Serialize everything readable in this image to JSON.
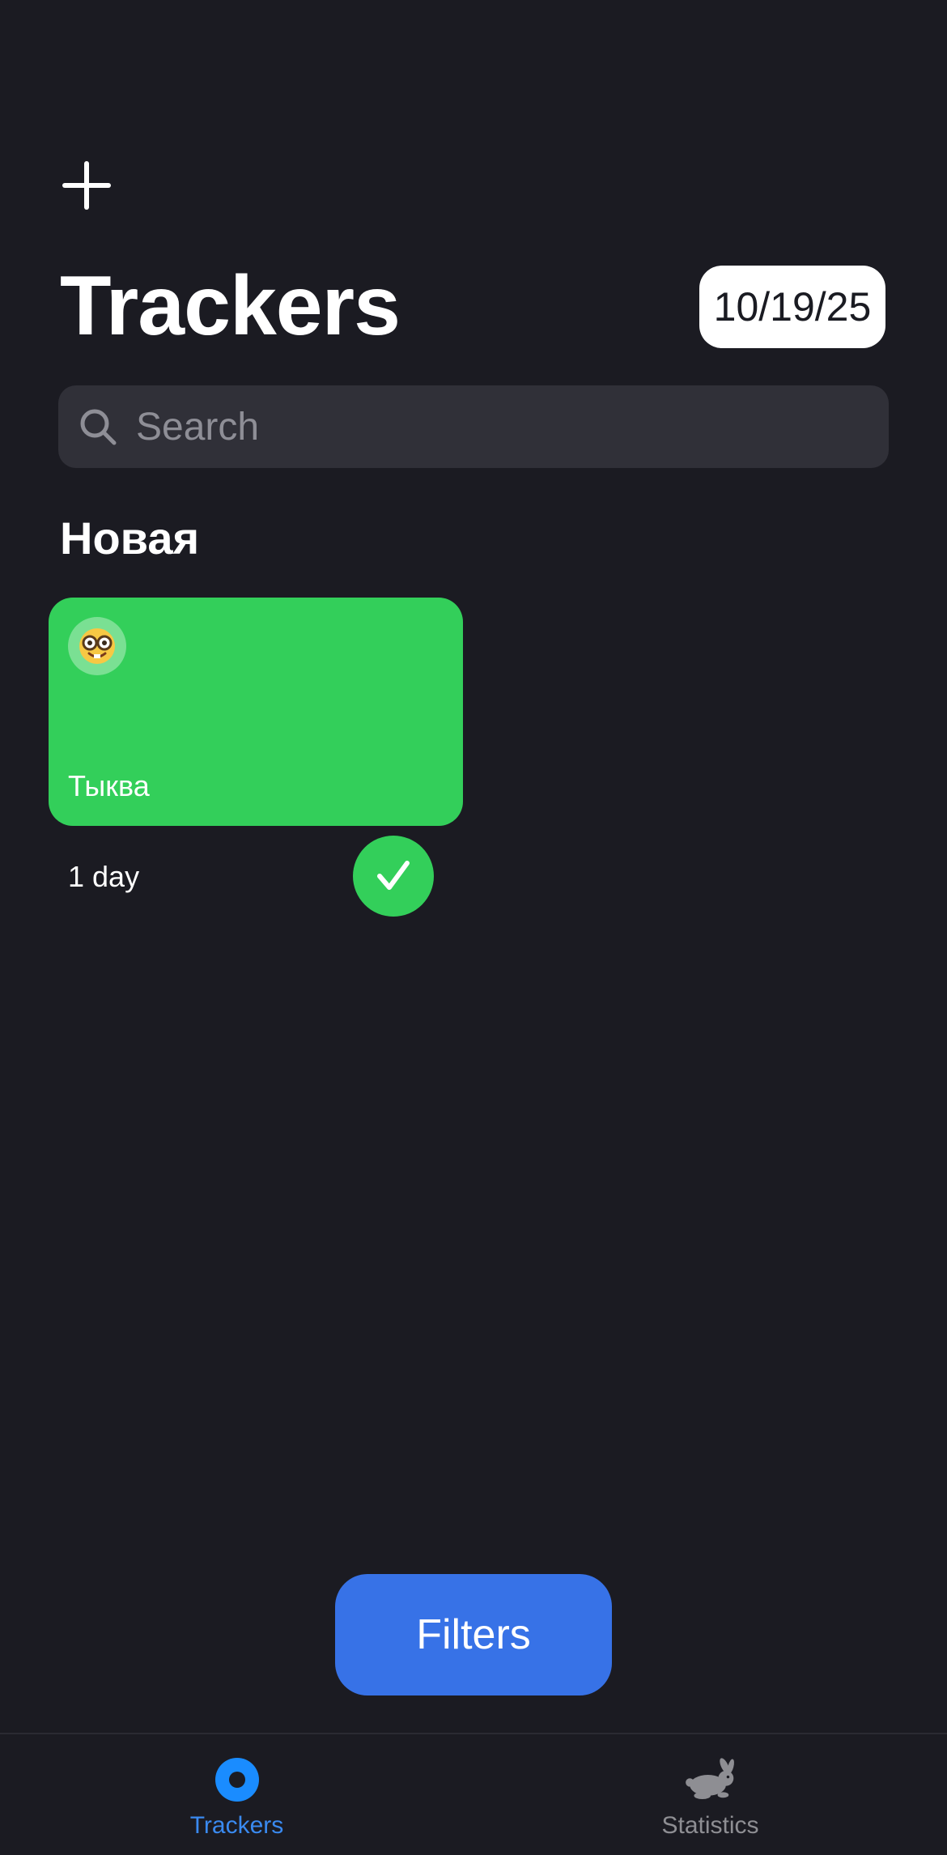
{
  "header": {
    "add_icon": "plus-icon",
    "title": "Trackers",
    "date": "10/19/25"
  },
  "search": {
    "placeholder": "Search",
    "value": "",
    "icon": "search-icon"
  },
  "sections": [
    {
      "title": "Новая",
      "trackers": [
        {
          "emoji": "🤓",
          "name": "Тыква",
          "color": "#33CF5A",
          "days_label": "1 day",
          "completed": true
        }
      ]
    }
  ],
  "filters_button": {
    "label": "Filters",
    "color": "#3772E7"
  },
  "tab_bar": {
    "tabs": [
      {
        "label": "Trackers",
        "icon": "trackers-record-icon",
        "active": true,
        "color": "#3A8AF0"
      },
      {
        "label": "Statistics",
        "icon": "rabbit-icon",
        "active": false,
        "color": "#8E8E93"
      }
    ]
  }
}
